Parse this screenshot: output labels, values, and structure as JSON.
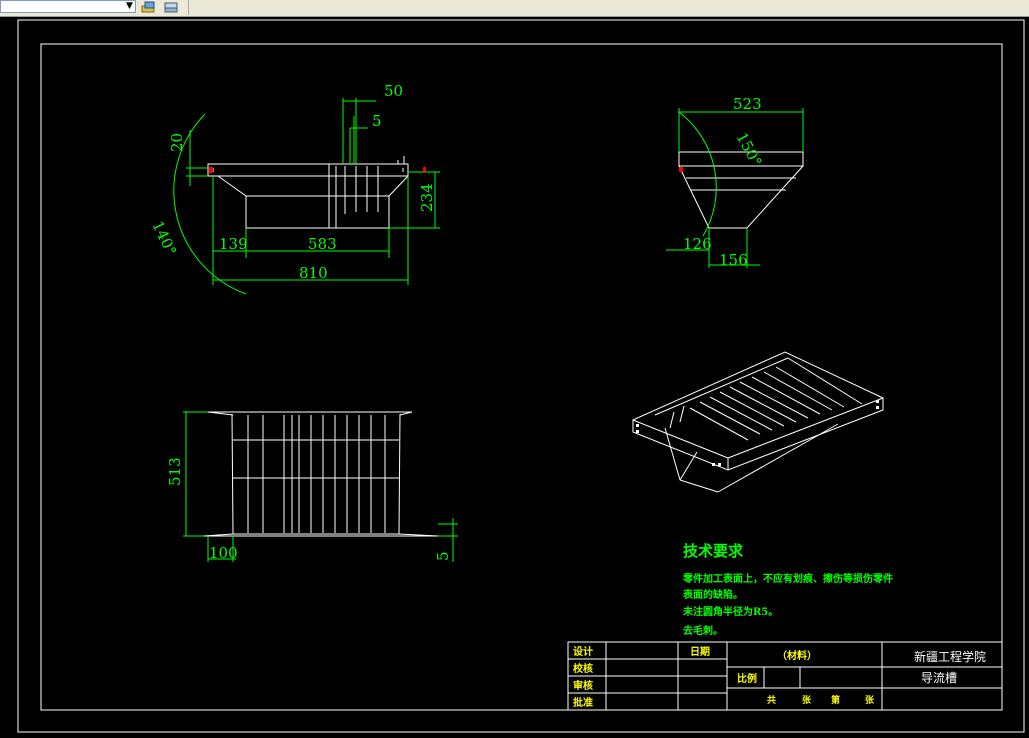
{
  "toolbar": {
    "layer_combo_value": ""
  },
  "dims": {
    "front": {
      "d50": "50",
      "d5": "5",
      "d20": "20",
      "d234": "234",
      "d139": "139",
      "d583": "583",
      "d810": "810",
      "ang140": "140°"
    },
    "side": {
      "d523": "523",
      "ang150": "150°",
      "d126": "126",
      "d156": "156"
    },
    "top": {
      "d513": "513",
      "d100": "100",
      "d5": "5"
    }
  },
  "notes": {
    "title": "技术要求",
    "lines": [
      "零件加工表面上，不应有划痕、擦伤等损伤零件",
      "表面的缺陷。",
      "未注圆角半径为R5。",
      "去毛刺。"
    ]
  },
  "title_block": {
    "design": "设计",
    "check": "校核",
    "review": "审核",
    "approve": "批准",
    "date": "日期",
    "material": "（材料）",
    "scale": "比例",
    "school": "新疆工程学院",
    "part_name": "导流槽",
    "sheet_total": "共",
    "sheet_unit1": "张",
    "sheet_no": "第",
    "sheet_unit2": "张"
  },
  "colors": {
    "background": "#000000",
    "geometry": "#ffffff",
    "dimension": "#00ff00",
    "notes": "#00ff00",
    "title_text": "#ffff00",
    "accent": "#ff0000"
  }
}
